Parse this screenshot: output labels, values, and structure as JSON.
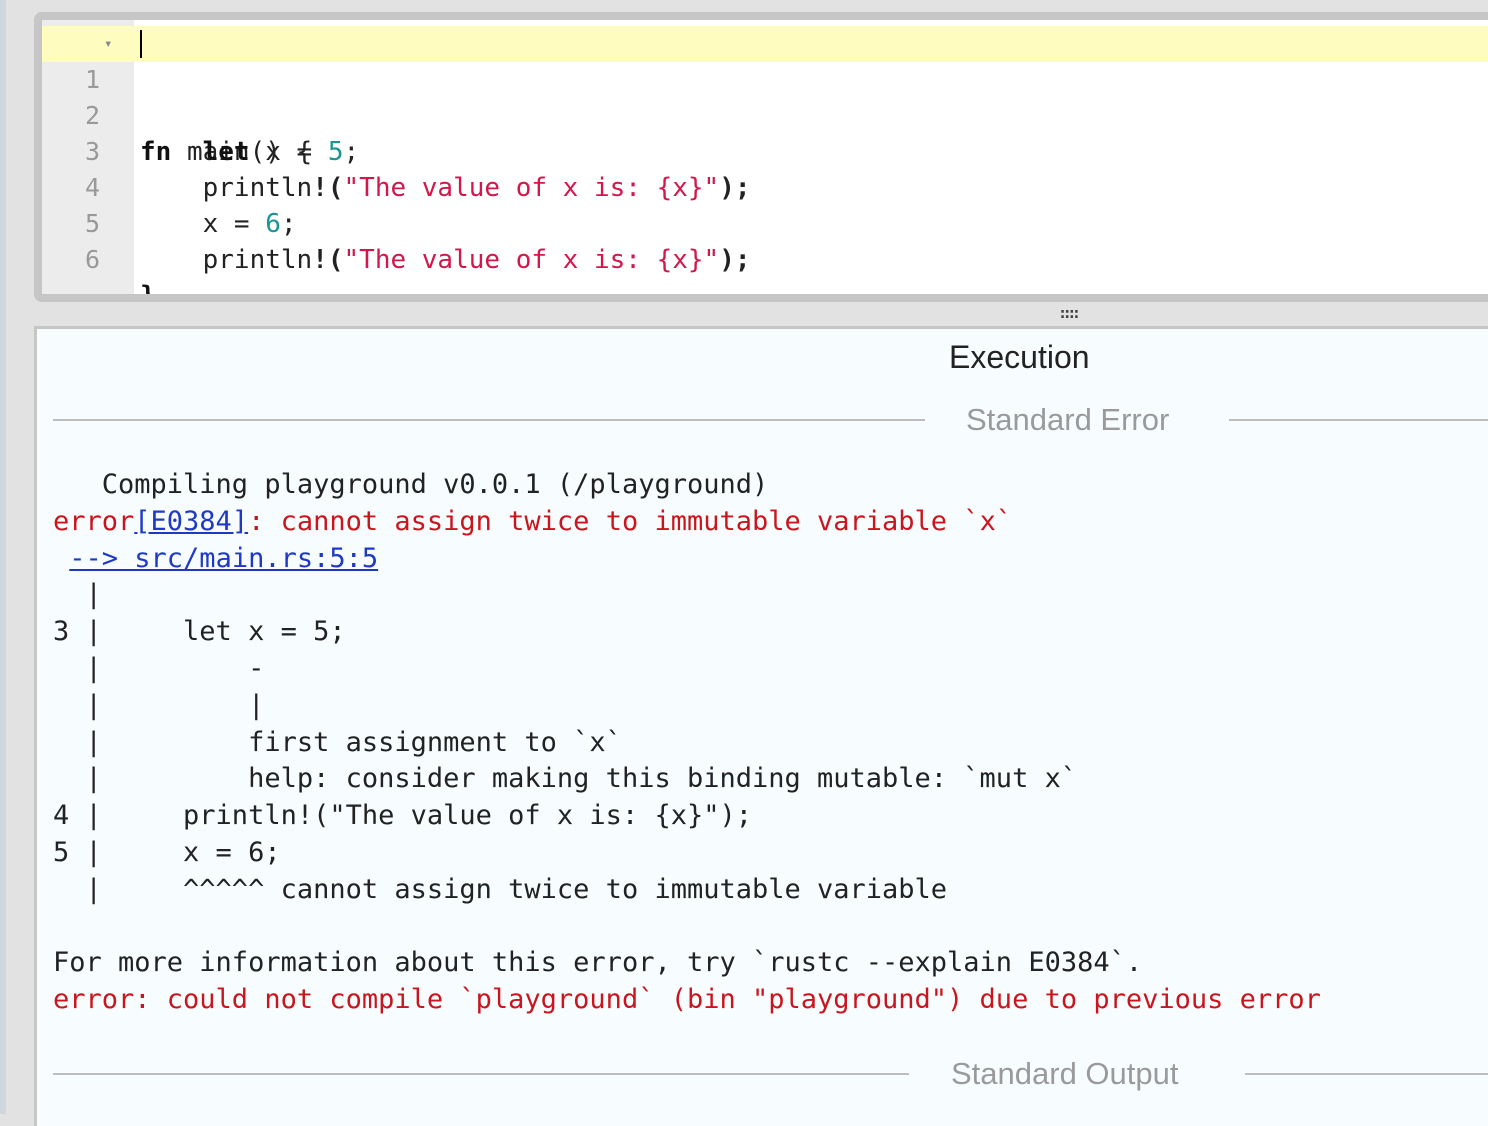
{
  "editor": {
    "lines": [
      {
        "n": "1",
        "code": "fn main() {"
      },
      {
        "n": "2",
        "code": "    let x = 5;"
      },
      {
        "n": "3",
        "code": "    println!(\"The value of x is: {x}\");"
      },
      {
        "n": "4",
        "code": "    x = 6;"
      },
      {
        "n": "5",
        "code": "    println!(\"The value of x is: {x}\");"
      },
      {
        "n": "6",
        "code": "}"
      }
    ],
    "tokens": {
      "fn": "fn",
      "main": " main() {",
      "let": "let",
      "x_eq": " x = ",
      "five": "5",
      "semi": ";",
      "println": "println",
      "bang": "!",
      "paren_open": "(",
      "str": "\"The value of x is: {x}\"",
      "paren_close": ");",
      "x_eq2": "x = ",
      "six": "6",
      "close_brace": "}"
    }
  },
  "splitter": {
    "glyph": "::::"
  },
  "output": {
    "title": "Execution",
    "stderr_label": "Standard Error",
    "stdout_label": "Standard Output",
    "stderr": {
      "l1": "   Compiling playground v0.0.1 (/playground)",
      "l2_a": "error",
      "l2_link": "[E0384]",
      "l2_b": ": cannot assign twice to immutable variable `x`",
      "l3_pre": " ",
      "l3_link": "--> src/main.rs:5:5",
      "l4": "  |",
      "l5": "3 |     let x = 5;",
      "l6": "  |         -",
      "l7": "  |         |",
      "l8": "  |         first assignment to `x`",
      "l9": "  |         help: consider making this binding mutable: `mut x`",
      "l10": "4 |     println!(\"The value of x is: {x}\");",
      "l11": "5 |     x = 6;",
      "l12": "  |     ^^^^^ cannot assign twice to immutable variable",
      "l13": "",
      "l14": "For more information about this error, try `rustc --explain E0384`.",
      "l15": "error: could not compile `playground` (bin \"playground\") due to previous error"
    }
  },
  "colors": {
    "error_red": "#c9161e",
    "link_blue": "#1f39c4",
    "number_teal": "#1a9494",
    "string_red": "#d1174c",
    "active_line": "#fffcbf"
  }
}
